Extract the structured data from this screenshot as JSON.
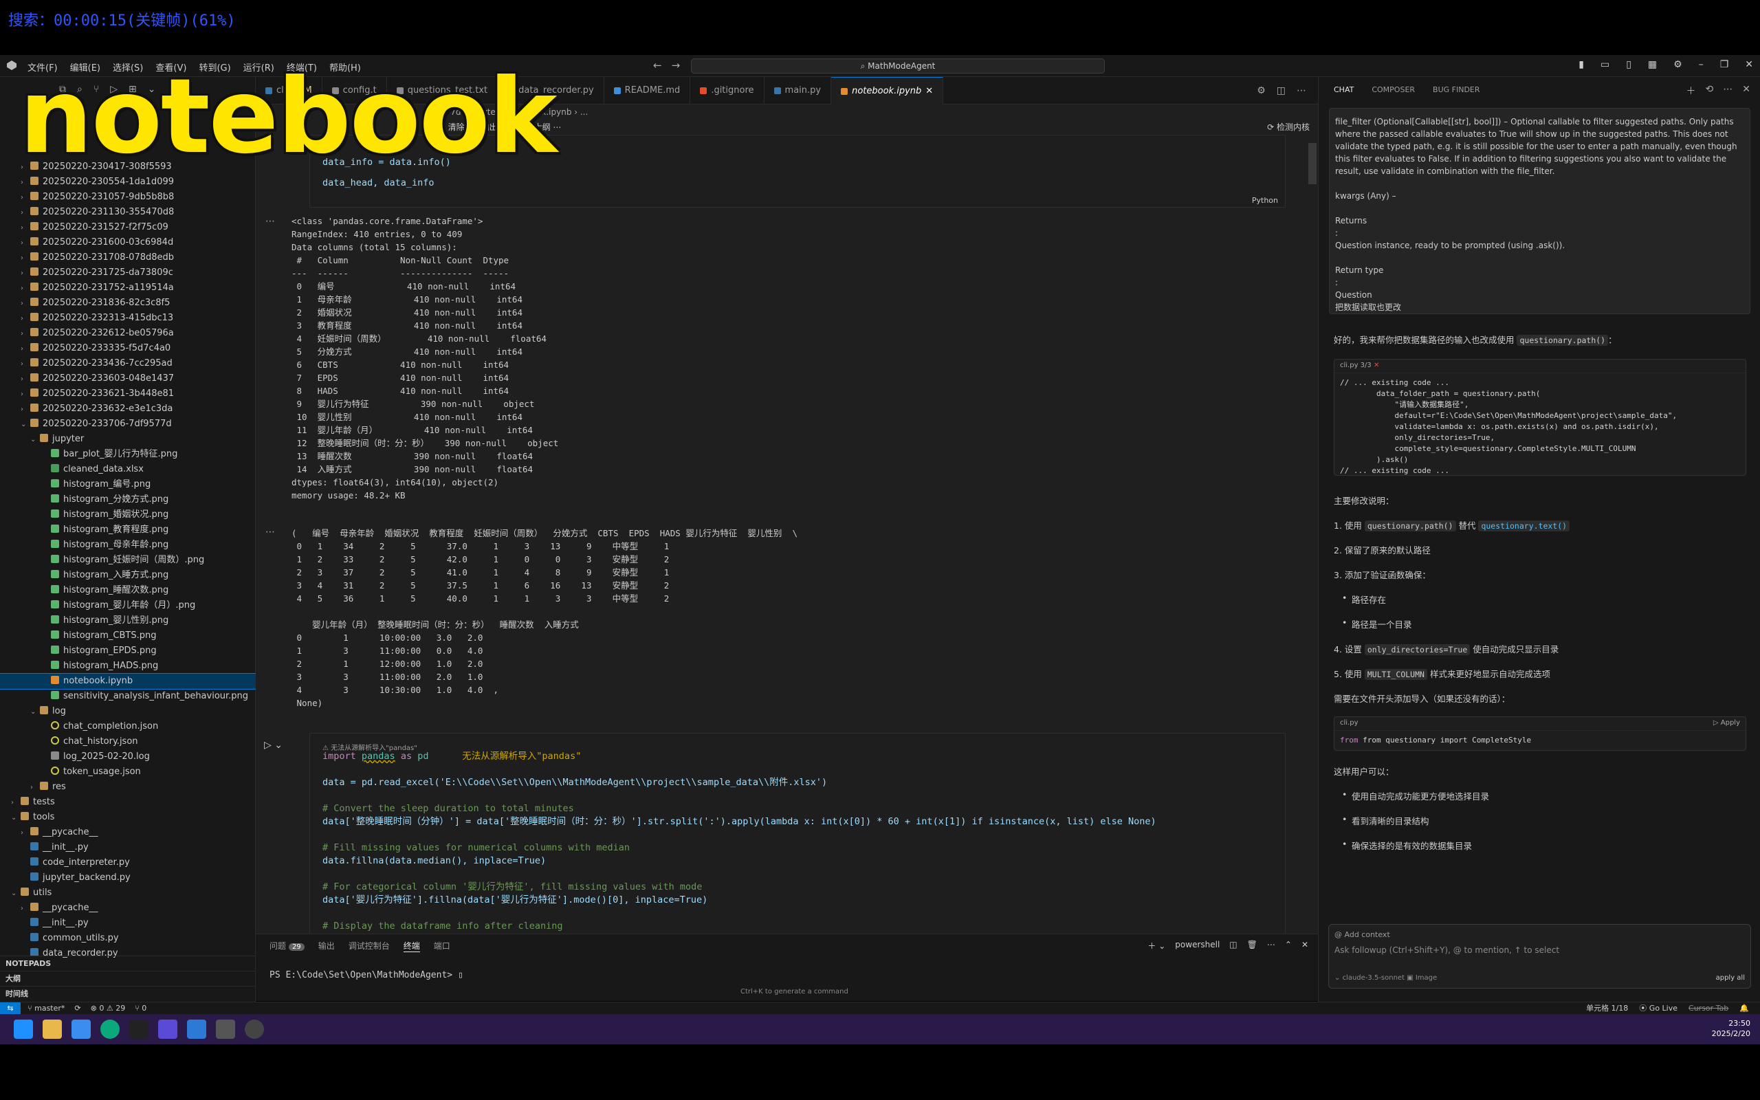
{
  "overlay": {
    "search_text": "搜索：00:00:15(关键帧)(61%)",
    "big_word": "notebook"
  },
  "titlebar": {
    "menus": [
      "文件(F)",
      "编辑(E)",
      "选择(S)",
      "查看(V)",
      "转到(G)",
      "运行(R)",
      "终端(T)",
      "帮助(H)"
    ],
    "search": "MathModeAgent"
  },
  "tabs": [
    {
      "label": "cli.py",
      "suffix": "M",
      "color": "#3776ab"
    },
    {
      "label": "config.t",
      "suffix": "",
      "color": "#8a8a8a"
    },
    {
      "label": "questions_test.txt",
      "suffix": "",
      "color": "#8a8a8a"
    },
    {
      "label": "data_recorder.py",
      "suffix": "",
      "color": "#3776ab"
    },
    {
      "label": "README.md",
      "suffix": "",
      "color": "#3c8fd8"
    },
    {
      "label": ".gitignore",
      "suffix": "",
      "color": "#e44d26"
    },
    {
      "label": "main.py",
      "suffix": "",
      "color": "#3776ab"
    },
    {
      "label": "notebook.ipynb",
      "suffix": "",
      "color": "#e48b2f",
      "active": true
    }
  ],
  "breadcrumb": "377d › jupyter › notebook.ipynb › ...",
  "nbtoolbar": {
    "clear": "清除所有输出",
    "outline": "大纲",
    "kernel": "检测内核"
  },
  "explorer": {
    "folders": [
      "20250220-230417-308f5593",
      "20250220-230554-1da1d099",
      "20250220-231057-9db5b8b8",
      "20250220-231130-355470d8",
      "20250220-231527-f2f75c09",
      "20250220-231600-03c6984d",
      "20250220-231708-078d8edb",
      "20250220-231725-da73809c",
      "20250220-231752-a119514a",
      "20250220-231836-82c3c8f5",
      "20250220-232313-415dbc13",
      "20250220-232612-be05796a",
      "20250220-233335-f5d7c4a0",
      "20250220-233436-7cc295ad",
      "20250220-233603-048e1437",
      "20250220-233621-3b448e81",
      "20250220-233632-e3e1c3da"
    ],
    "open_folder": "20250220-233706-7df9577d",
    "jupyter_folder": "jupyter",
    "jupyter_files": [
      {
        "name": "bar_plot_婴儿行为特征.png",
        "type": "png"
      },
      {
        "name": "cleaned_data.xlsx",
        "type": "xlsx"
      },
      {
        "name": "histogram_编号.png",
        "type": "png"
      },
      {
        "name": "histogram_分娩方式.png",
        "type": "png"
      },
      {
        "name": "histogram_婚姻状况.png",
        "type": "png"
      },
      {
        "name": "histogram_教育程度.png",
        "type": "png"
      },
      {
        "name": "histogram_母亲年龄.png",
        "type": "png"
      },
      {
        "name": "histogram_妊娠时间（周数）.png",
        "type": "png"
      },
      {
        "name": "histogram_入睡方式.png",
        "type": "png"
      },
      {
        "name": "histogram_睡醒次数.png",
        "type": "png"
      },
      {
        "name": "histogram_婴儿年龄（月）.png",
        "type": "png"
      },
      {
        "name": "histogram_婴儿性别.png",
        "type": "png"
      },
      {
        "name": "histogram_CBTS.png",
        "type": "png"
      },
      {
        "name": "histogram_EPDS.png",
        "type": "png"
      },
      {
        "name": "histogram_HADS.png",
        "type": "png"
      },
      {
        "name": "notebook.ipynb",
        "type": "ipynb",
        "selected": true
      },
      {
        "name": "sensitivity_analysis_infant_behaviour.png",
        "type": "png"
      }
    ],
    "log_folder": "log",
    "log_files": [
      {
        "name": "chat_completion.json",
        "type": "json"
      },
      {
        "name": "chat_history.json",
        "type": "json"
      },
      {
        "name": "log_2025-02-20.log",
        "type": "log"
      },
      {
        "name": "token_usage.json",
        "type": "json"
      }
    ],
    "res_folder": "res",
    "tests_folder": "tests",
    "tools_folder": "tools",
    "tools_files": [
      {
        "name": "__pycache__",
        "type": "folder"
      },
      {
        "name": "__init__.py",
        "type": "py"
      },
      {
        "name": "code_interpreter.py",
        "type": "py"
      },
      {
        "name": "jupyter_backend.py",
        "type": "py"
      }
    ],
    "utils_folder": "utils",
    "utils_files": [
      {
        "name": "__pycache__",
        "type": "folder"
      },
      {
        "name": "__init__.py",
        "type": "py"
      },
      {
        "name": "common_utils.py",
        "type": "py"
      },
      {
        "name": "data_recorder.py",
        "type": "py"
      }
    ],
    "sections": [
      "NOTEPADS",
      "大纲",
      "时间线"
    ]
  },
  "cell1": {
    "code_line1": "data_info = data.info()",
    "code_line2": "data_head, data_info",
    "lang": "Python"
  },
  "output1": "<class 'pandas.core.frame.DataFrame'>\nRangeIndex: 410 entries, 0 to 409\nData columns (total 15 columns):\n #   Column          Non-Null Count  Dtype  \n---  ------          --------------  -----  \n 0   编号              410 non-null    int64  \n 1   母亲年龄            410 non-null    int64  \n 2   婚姻状况            410 non-null    int64  \n 3   教育程度            410 non-null    int64  \n 4   妊娠时间（周数）        410 non-null    float64\n 5   分娩方式            410 non-null    int64  \n 6   CBTS            410 non-null    int64  \n 7   EPDS            410 non-null    int64  \n 8   HADS            410 non-null    int64  \n 9   婴儿行为特征          390 non-null    object \n 10  婴儿性别            410 non-null    int64  \n 11  婴儿年龄（月）         410 non-null    int64  \n 12  整晚睡眠时间（时：分：秒）   390 non-null    object \n 13  睡醒次数            390 non-null    float64\n 14  入睡方式            390 non-null    float64\ndtypes: float64(3), int64(10), object(2)\nmemory usage: 48.2+ KB",
  "output2": "(   编号  母亲年龄  婚姻状况  教育程度  妊娠时间（周数）  分娩方式  CBTS  EPDS  HADS 婴儿行为特征  婴儿性别  \\\n 0   1    34     2     5      37.0     1     3    13     9    中等型     1   \n 1   2    33     2     5      42.0     1     0     0     3    安静型     2   \n 2   3    37     2     5      41.0     1     4     8     9    安静型     1   \n 3   4    31     2     5      37.5     1     6    16    13    安静型     2   \n 4   5    36     1     5      40.0     1     1     3     3    中等型     2   \n \n    婴儿年龄（月） 整晚睡眠时间（时：分：秒）  睡醒次数  入睡方式  \n 0        1      10:00:00   3.0   2.0  \n 1        3      11:00:00   0.0   4.0  \n 2        1      12:00:00   1.0   2.0  \n 3        3      11:00:00   2.0   1.0  \n 4        3      10:30:00   1.0   4.0  ,\n None)",
  "cell2": {
    "warning_small": "无法从源解析导入\"pandas\"",
    "warning_inline": "无法从源解析导入\"pandas\"",
    "l1_kw": "import",
    "l1_mod": "pandas",
    "l1_as": "as",
    "l1_alias": "pd",
    "l2": "data = pd.read_excel('E:\\\\Code\\\\Set\\\\Open\\\\MathModeAgent\\\\project\\\\sample_data\\\\附件.xlsx')",
    "c3": "# Convert the sleep duration to total minutes",
    "l3": "data['整晚睡眠时间（分钟）'] = data['整晚睡眠时间（时：分：秒）'].str.split(':').apply(lambda x: int(x[0]) * 60 + int(x[1]) if isinstance(x, list) else None)",
    "c4": "# Fill missing values for numerical columns with median",
    "l4": "data.fillna(data.median(), inplace=True)",
    "c5": "# For categorical column '婴儿行为特征', fill missing values with mode",
    "l5": "data['婴儿行为特征'].fillna(data['婴儿行为特征'].mode()[0], inplace=True)",
    "c6": "# Display the dataframe info after cleaning"
  },
  "panel": {
    "tabs": [
      "问题",
      "输出",
      "调试控制台",
      "终端",
      "端口"
    ],
    "problems_count": "29",
    "shell": "powershell",
    "prompt": "PS E:\\Code\\Set\\Open\\MathModeAgent> ",
    "hint": "Ctrl+K to generate a command"
  },
  "chat": {
    "tabs": [
      "CHAT",
      "COMPOSER",
      "BUG FINDER"
    ],
    "user_p1": "file_filter (Optional[Callable[[str], bool]]) – Optional callable to filter suggested paths. Only paths where the passed callable evaluates to True will show up in the suggested paths. This does not validate the typed path, e.g. it is still possible for the user to enter a path manually, even though this filter evaluates to False. If in addition to filtering suggestions you also want to validate the result, use validate in combination with the file_filter.",
    "user_p2": "kwargs (Any) –",
    "user_p3": "Returns\n:\nQuestion instance, ready to be prompted (using .ask()).",
    "user_p4": "Return type\n:\nQuestion",
    "user_p5": "把数据读取也更改",
    "reply_intro_a": "好的，我来帮你把数据集路径的输入也改成使用 ",
    "reply_intro_code": "questionary.path()",
    "reply_intro_b": "：",
    "cb1_file": "cli.py 3/3",
    "cb1_code": "// ... existing code ...\n        data_folder_path = questionary.path(\n            \"请输入数据集路径\",\n            default=r\"E:\\Code\\Set\\Open\\MathModeAgent\\project\\sample_data\",\n            validate=lambda x: os.path.exists(x) and os.path.isdir(x),\n            only_directories=True,\n            complete_style=questionary.CompleteStyle.MULTI_COLUMN\n        ).ask()\n// ... existing code ...",
    "changes_title": "主要修改说明：",
    "ch1_a": "1. 使用 ",
    "ch1_c1": "questionary.path()",
    "ch1_b": " 替代 ",
    "ch1_c2": "questionary.text()",
    "ch2": "2. 保留了原来的默认路径",
    "ch3": "3. 添加了验证函数确保：",
    "ch3_b1": "路径存在",
    "ch3_b2": "路径是一个目录",
    "ch4_a": "4. 设置 ",
    "ch4_c": "only_directories=True",
    "ch4_b": " 使自动完成只显示目录",
    "ch5_a": "5. 使用 ",
    "ch5_c": "MULTI_COLUMN",
    "ch5_b": " 样式来更好地显示自动完成选项",
    "import_note": "需要在文件开头添加导入（如果还没有的话）：",
    "cb2_file": "cli.py",
    "cb2_apply": "Apply",
    "cb2_code": "from questionary import CompleteStyle",
    "benefit_title": "这样用户可以：",
    "benefits": [
      "使用自动完成功能更方便地选择目录",
      "看到清晰的目录结构",
      "确保选择的是有效的数据集目录"
    ],
    "add_context": "Add context",
    "placeholder": "Ask followup (Ctrl+Shift+Y), @ to mention, ↑ to select",
    "model": "claude-3.5-sonnet",
    "image": "Image",
    "apply_all": "apply all"
  },
  "statusbar": {
    "branch": "master*",
    "errors": "⊗ 0 ⚠ 29",
    "ports": "⑂ 0",
    "cell_pos": "单元格 1/18",
    "golive": "Go Live",
    "cursortab": "Cursor Tab"
  },
  "taskbar": {
    "time": "23:50",
    "date": "2025/2/20"
  }
}
